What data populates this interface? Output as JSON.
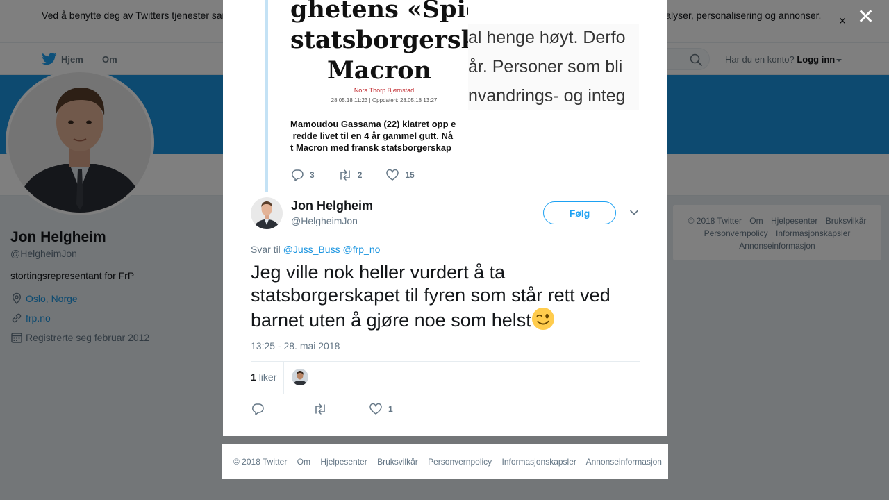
{
  "cookie_banner": {
    "text": "Ved å benytte deg av Twitters tjenester samtykker du i vår bruk av informasjonskapsler. Vi og våre partnere bruker informasjonskapsler til bl.a. analyser, personalisering og annonser.",
    "close_label": "×"
  },
  "topnav": {
    "home_label": "Hjem",
    "about_label": "Om",
    "account_prompt": "Har du en konto?",
    "login_label": "Logg inn"
  },
  "profile": {
    "name": "Jon Helgheim",
    "handle": "@HelgheimJon",
    "bio": "stortingsrepresentant for FrP",
    "location": "Oslo, Norge",
    "website": "frp.no",
    "joined": "Registrerte seg februar 2012"
  },
  "side_footer": {
    "links": [
      "© 2018 Twitter",
      "Om",
      "Hjelpesenter",
      "Bruksvilkår",
      "Personvernpolicy",
      "Informasjonskapsler",
      "Annonseinformasjon"
    ]
  },
  "overlay": {
    "close_label": "✕"
  },
  "previous_tweet": {
    "image": {
      "title_lines": [
        "ghetens «Spid",
        "statsborgersk",
        "Macron"
      ],
      "author": "Nora Thorp Bjørnstad",
      "meta": "28.05.18 11:23  |  Oppdatert: 28.05.18 13:27",
      "body": "Mamoudou Gassama (22) klatret opp e\n redde livet til en 4 år gammel gutt. Nå\nt Macron med fransk statsborgerskap"
    },
    "image2": {
      "lines": [
        "al henge høyt. Derfo",
        "år. Personer som bli",
        "nvandrings- og integ"
      ]
    },
    "replies": "3",
    "retweets": "2",
    "likes": "15"
  },
  "tweet": {
    "author_name": "Jon Helgheim",
    "author_handle": "@HelgheimJon",
    "follow_label": "Følg",
    "reply_prefix": "Svar til",
    "mentions": [
      "@Juss_Buss",
      "@frp_no"
    ],
    "text": "Jeg ville nok heller vurdert å ta statsborgerskapet til fyren som står rett ved barnet uten å gjøre noe som helst",
    "timestamp": "13:25 - 28. mai 2018",
    "like_count": "1",
    "like_word": "liker",
    "likes": "1"
  },
  "bottom_footer": {
    "links": [
      "© 2018 Twitter",
      "Om",
      "Hjelpesenter",
      "Bruksvilkår",
      "Personvernpolicy",
      "Informasjonskapsler",
      "Annonseinformasjon"
    ]
  },
  "colors": {
    "accent": "#1da1f2",
    "link": "#1b95e0",
    "header_banner": "#1b95e0",
    "secondary_text": "#657786"
  },
  "icons": [
    "twitter-bird-icon",
    "search-icon",
    "location-icon",
    "link-icon",
    "calendar-icon",
    "reply-icon",
    "retweet-icon",
    "like-icon",
    "chevron-down-icon",
    "wink-emoji-icon",
    "close-icon"
  ]
}
